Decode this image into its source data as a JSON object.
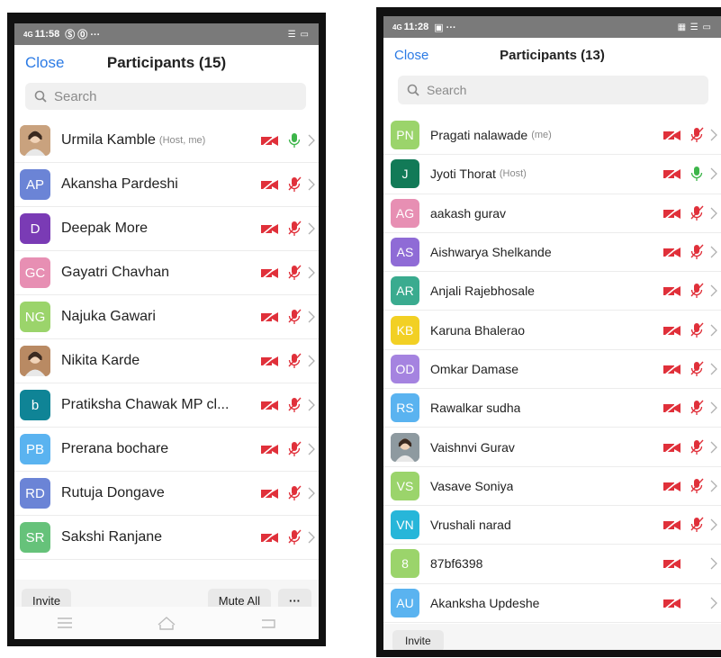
{
  "left": {
    "status": {
      "time": "11:58",
      "signal": "4G",
      "extras": "Ⓢ ⓪ ···",
      "right": "☰ ▭"
    },
    "title": "Participants (15)",
    "close_label": "Close",
    "search_placeholder": "Search",
    "participants": [
      {
        "initials": "",
        "photo": true,
        "color": "#c9a27e",
        "name": "Urmila Kamble",
        "tag": "(Host, me)",
        "mic": "on",
        "video": "off"
      },
      {
        "initials": "AP",
        "color": "#6b84d6",
        "name": "Akansha Pardeshi",
        "tag": "",
        "mic": "muted",
        "video": "off"
      },
      {
        "initials": "D",
        "color": "#7a3bb5",
        "name": "Deepak More",
        "tag": "",
        "mic": "muted",
        "video": "off"
      },
      {
        "initials": "GC",
        "color": "#e78fb3",
        "name": "Gayatri Chavhan",
        "tag": "",
        "mic": "muted",
        "video": "off"
      },
      {
        "initials": "NG",
        "color": "#9bd46b",
        "name": "Najuka Gawari",
        "tag": "",
        "mic": "muted",
        "video": "off"
      },
      {
        "initials": "",
        "photo": true,
        "color": "#b98a63",
        "name": "Nikita Karde",
        "tag": "",
        "mic": "muted",
        "video": "off"
      },
      {
        "initials": "b",
        "color": "#0f8496",
        "name": "Pratiksha Chawak MP cl...",
        "tag": "",
        "mic": "muted",
        "video": "off"
      },
      {
        "initials": "PB",
        "color": "#5ab3f0",
        "name": "Prerana bochare",
        "tag": "",
        "mic": "muted",
        "video": "off"
      },
      {
        "initials": "RD",
        "color": "#6b84d6",
        "name": "Rutuja Dongave",
        "tag": "",
        "mic": "muted",
        "video": "off"
      },
      {
        "initials": "SR",
        "color": "#66c27a",
        "name": "Sakshi Ranjane",
        "tag": "",
        "mic": "muted",
        "video": "off"
      }
    ],
    "invite_label": "Invite",
    "mute_all_label": "Mute All",
    "more_label": "···"
  },
  "right": {
    "status": {
      "time": "11:28",
      "signal": "4G",
      "extras": "▣ ···",
      "right": "▦ ☰ ▭"
    },
    "title": "Participants (13)",
    "close_label": "Close",
    "search_placeholder": "Search",
    "participants": [
      {
        "initials": "PN",
        "color": "#9bd46b",
        "name": "Pragati nalawade",
        "tag": "(me)",
        "mic": "muted",
        "video": "off"
      },
      {
        "initials": "J",
        "color": "#127a57",
        "name": "Jyoti Thorat",
        "tag": "(Host)",
        "mic": "on",
        "video": "off"
      },
      {
        "initials": "AG",
        "color": "#e78fb3",
        "name": "aakash gurav",
        "tag": "",
        "mic": "muted",
        "video": "off"
      },
      {
        "initials": "AS",
        "color": "#8f6bd6",
        "name": "Aishwarya Shelkande",
        "tag": "",
        "mic": "muted",
        "video": "off"
      },
      {
        "initials": "AR",
        "color": "#3aab8f",
        "name": "Anjali Rajebhosale",
        "tag": "",
        "mic": "muted",
        "video": "off"
      },
      {
        "initials": "KB",
        "color": "#f2d024",
        "name": "Karuna Bhalerao",
        "tag": "",
        "mic": "muted",
        "video": "off"
      },
      {
        "initials": "OD",
        "color": "#a583e0",
        "name": "Omkar Damase",
        "tag": "",
        "mic": "muted",
        "video": "off"
      },
      {
        "initials": "RS",
        "color": "#5ab3f0",
        "name": "Rawalkar sudha",
        "tag": "",
        "mic": "muted",
        "video": "off"
      },
      {
        "initials": "",
        "photo": true,
        "color": "#8e9aa0",
        "name": "Vaishnvi Gurav",
        "tag": "",
        "mic": "muted",
        "video": "off"
      },
      {
        "initials": "VS",
        "color": "#9bd46b",
        "name": "Vasave Soniya",
        "tag": "",
        "mic": "muted",
        "video": "off"
      },
      {
        "initials": "VN",
        "color": "#27b6d9",
        "name": "Vrushali narad",
        "tag": "",
        "mic": "muted",
        "video": "off"
      },
      {
        "initials": "8",
        "color": "#9bd46b",
        "name": "87bf6398",
        "tag": "",
        "mic": "none",
        "video": "off"
      },
      {
        "initials": "AU",
        "color": "#5ab3f0",
        "name": "Akanksha Updeshe",
        "tag": "",
        "mic": "none",
        "video": "off"
      }
    ],
    "invite_label": "Invite"
  },
  "icons": {
    "video_off_color": "#e0303a",
    "mic_muted_color": "#e0303a",
    "mic_on_color": "#3db54a",
    "chevron_color": "#b0b0b0"
  }
}
